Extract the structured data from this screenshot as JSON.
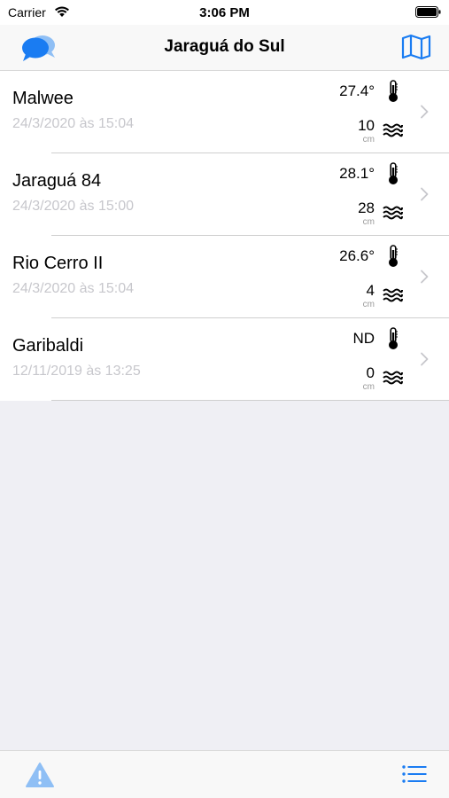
{
  "status_bar": {
    "carrier": "Carrier",
    "time": "3:06 PM",
    "icons": [
      "wifi-icon",
      "battery-icon"
    ]
  },
  "nav": {
    "title": "Jaraguá do Sul",
    "left_icon": "chat-bubbles-icon",
    "right_icon": "map-icon"
  },
  "colors": {
    "accent": "#1a7cf2",
    "accent_light": "#8fbff5",
    "date_text": "#c7c7cc",
    "background": "#efeff4"
  },
  "stations": [
    {
      "name": "Malwee",
      "date": "24/3/2020 às 15:04",
      "temperature": "27.4°",
      "level": "10",
      "unit": "cm"
    },
    {
      "name": "Jaraguá 84",
      "date": "24/3/2020 às 15:00",
      "temperature": "28.1°",
      "level": "28",
      "unit": "cm"
    },
    {
      "name": "Rio Cerro II",
      "date": "24/3/2020 às 15:04",
      "temperature": "26.6°",
      "level": "4",
      "unit": "cm"
    },
    {
      "name": "Garibaldi",
      "date": "12/11/2019 às 13:25",
      "temperature": "ND",
      "level": "0",
      "unit": "cm"
    }
  ],
  "tab_bar": {
    "left_icon": "warning-triangle-icon",
    "right_icon": "list-icon"
  }
}
